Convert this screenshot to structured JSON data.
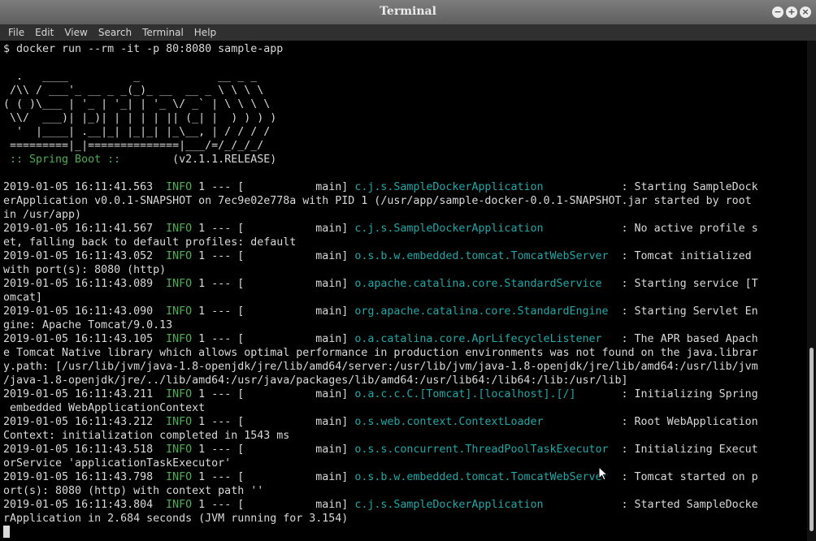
{
  "window": {
    "title": "Terminal"
  },
  "window_buttons": [
    {
      "name": "minimize-window-button",
      "glyph": "−",
      "icon": "minimize-icon"
    },
    {
      "name": "maximize-window-button",
      "glyph": "+",
      "icon": "maximize-icon"
    },
    {
      "name": "close-window-button",
      "glyph": "×",
      "icon": "close-icon"
    }
  ],
  "menu": [
    "File",
    "Edit",
    "View",
    "Search",
    "Terminal",
    "Help"
  ],
  "colors": {
    "background": "#000000",
    "text": "#d9d9d9",
    "info_green": "#4caf50",
    "logger_cyan": "#1fa8a8",
    "spring_green": "#4caf50",
    "titlebar": "#6e6e6e",
    "menubar": "#303030"
  },
  "terminal_lines": [
    [
      {
        "t": "$ docker run --rm -it -p 80:8080 sample-app"
      }
    ],
    [
      {
        "t": ""
      }
    ],
    [
      {
        "t": "  .   ____          _            __ _ _"
      }
    ],
    [
      {
        "t": " /\\\\ / ___'_ __ _ _(_)_ __  __ _ \\ \\ \\ \\"
      }
    ],
    [
      {
        "t": "( ( )\\___ | '_ | '_| | '_ \\/ _` | \\ \\ \\ \\"
      }
    ],
    [
      {
        "t": " \\\\/  ___)| |_)| | | | | || (_| |  ) ) ) )"
      }
    ],
    [
      {
        "t": "  '  |____| .__|_| |_|_| |_\\__, | / / / /"
      }
    ],
    [
      {
        "t": " =========|_|==============|___/=/_/_/_/"
      }
    ],
    [
      {
        "t": " :: Spring Boot :: ",
        "c": "green"
      },
      {
        "t": "       (v2.1.1.RELEASE)"
      }
    ],
    [
      {
        "t": ""
      }
    ],
    [
      {
        "t": "2019-01-05 16:11:41.563  "
      },
      {
        "t": "INFO",
        "c": "green"
      },
      {
        "t": " 1 --- [           main] "
      },
      {
        "t": "c.j.s.SampleDockerApplication           ",
        "c": "cyan"
      },
      {
        "t": " : Starting SampleDock"
      }
    ],
    [
      {
        "t": "erApplication v0.0.1-SNAPSHOT on 7ec9e02e778a with PID 1 (/usr/app/sample-docker-0.0.1-SNAPSHOT.jar started by root"
      }
    ],
    [
      {
        "t": "in /usr/app)"
      }
    ],
    [
      {
        "t": "2019-01-05 16:11:41.567  "
      },
      {
        "t": "INFO",
        "c": "green"
      },
      {
        "t": " 1 --- [           main] "
      },
      {
        "t": "c.j.s.SampleDockerApplication           ",
        "c": "cyan"
      },
      {
        "t": " : No active profile s"
      }
    ],
    [
      {
        "t": "et, falling back to default profiles: default"
      }
    ],
    [
      {
        "t": "2019-01-05 16:11:43.052  "
      },
      {
        "t": "INFO",
        "c": "green"
      },
      {
        "t": " 1 --- [           main] "
      },
      {
        "t": "o.s.b.w.embedded.tomcat.TomcatWebServer ",
        "c": "cyan"
      },
      {
        "t": " : Tomcat initialized "
      }
    ],
    [
      {
        "t": "with port(s): 8080 (http)"
      }
    ],
    [
      {
        "t": "2019-01-05 16:11:43.089  "
      },
      {
        "t": "INFO",
        "c": "green"
      },
      {
        "t": " 1 --- [           main] "
      },
      {
        "t": "o.apache.catalina.core.StandardService  ",
        "c": "cyan"
      },
      {
        "t": " : Starting service [T"
      }
    ],
    [
      {
        "t": "omcat]"
      }
    ],
    [
      {
        "t": "2019-01-05 16:11:43.090  "
      },
      {
        "t": "INFO",
        "c": "green"
      },
      {
        "t": " 1 --- [           main] "
      },
      {
        "t": "org.apache.catalina.core.StandardEngine ",
        "c": "cyan"
      },
      {
        "t": " : Starting Servlet En"
      }
    ],
    [
      {
        "t": "gine: Apache Tomcat/9.0.13"
      }
    ],
    [
      {
        "t": "2019-01-05 16:11:43.105  "
      },
      {
        "t": "INFO",
        "c": "green"
      },
      {
        "t": " 1 --- [           main] "
      },
      {
        "t": "o.a.catalina.core.AprLifecycleListener  ",
        "c": "cyan"
      },
      {
        "t": " : The APR based Apach"
      }
    ],
    [
      {
        "t": "e Tomcat Native library which allows optimal performance in production environments was not found on the java.librar"
      }
    ],
    [
      {
        "t": "y.path: [/usr/lib/jvm/java-1.8-openjdk/jre/lib/amd64/server:/usr/lib/jvm/java-1.8-openjdk/jre/lib/amd64:/usr/lib/jvm"
      }
    ],
    [
      {
        "t": "/java-1.8-openjdk/jre/../lib/amd64:/usr/java/packages/lib/amd64:/usr/lib64:/lib64:/lib:/usr/lib]"
      }
    ],
    [
      {
        "t": "2019-01-05 16:11:43.211  "
      },
      {
        "t": "INFO",
        "c": "green"
      },
      {
        "t": " 1 --- [           main] "
      },
      {
        "t": "o.a.c.c.C.[Tomcat].[localhost].[/]      ",
        "c": "cyan"
      },
      {
        "t": " : Initializing Spring"
      }
    ],
    [
      {
        "t": " embedded WebApplicationContext"
      }
    ],
    [
      {
        "t": "2019-01-05 16:11:43.212  "
      },
      {
        "t": "INFO",
        "c": "green"
      },
      {
        "t": " 1 --- [           main] "
      },
      {
        "t": "o.s.web.context.ContextLoader           ",
        "c": "cyan"
      },
      {
        "t": " : Root WebApplication"
      }
    ],
    [
      {
        "t": "Context: initialization completed in 1543 ms"
      }
    ],
    [
      {
        "t": "2019-01-05 16:11:43.518  "
      },
      {
        "t": "INFO",
        "c": "green"
      },
      {
        "t": " 1 --- [           main] "
      },
      {
        "t": "o.s.s.concurrent.ThreadPoolTaskExecutor ",
        "c": "cyan"
      },
      {
        "t": " : Initializing Execut"
      }
    ],
    [
      {
        "t": "orService 'applicationTaskExecutor'"
      }
    ],
    [
      {
        "t": "2019-01-05 16:11:43.798  "
      },
      {
        "t": "INFO",
        "c": "green"
      },
      {
        "t": " 1 --- [           main] "
      },
      {
        "t": "o.s.b.w.embedded.tomcat.TomcatWebServer ",
        "c": "cyan"
      },
      {
        "t": " : Tomcat started on p"
      }
    ],
    [
      {
        "t": "ort(s): 8080 (http) with context path ''"
      }
    ],
    [
      {
        "t": "2019-01-05 16:11:43.804  "
      },
      {
        "t": "INFO",
        "c": "green"
      },
      {
        "t": " 1 --- [           main] "
      },
      {
        "t": "c.j.s.SampleDockerApplication           ",
        "c": "cyan"
      },
      {
        "t": " : Started SampleDocke"
      }
    ],
    [
      {
        "t": "rApplication in 2.684 seconds (JVM running for 3.154)"
      }
    ]
  ]
}
